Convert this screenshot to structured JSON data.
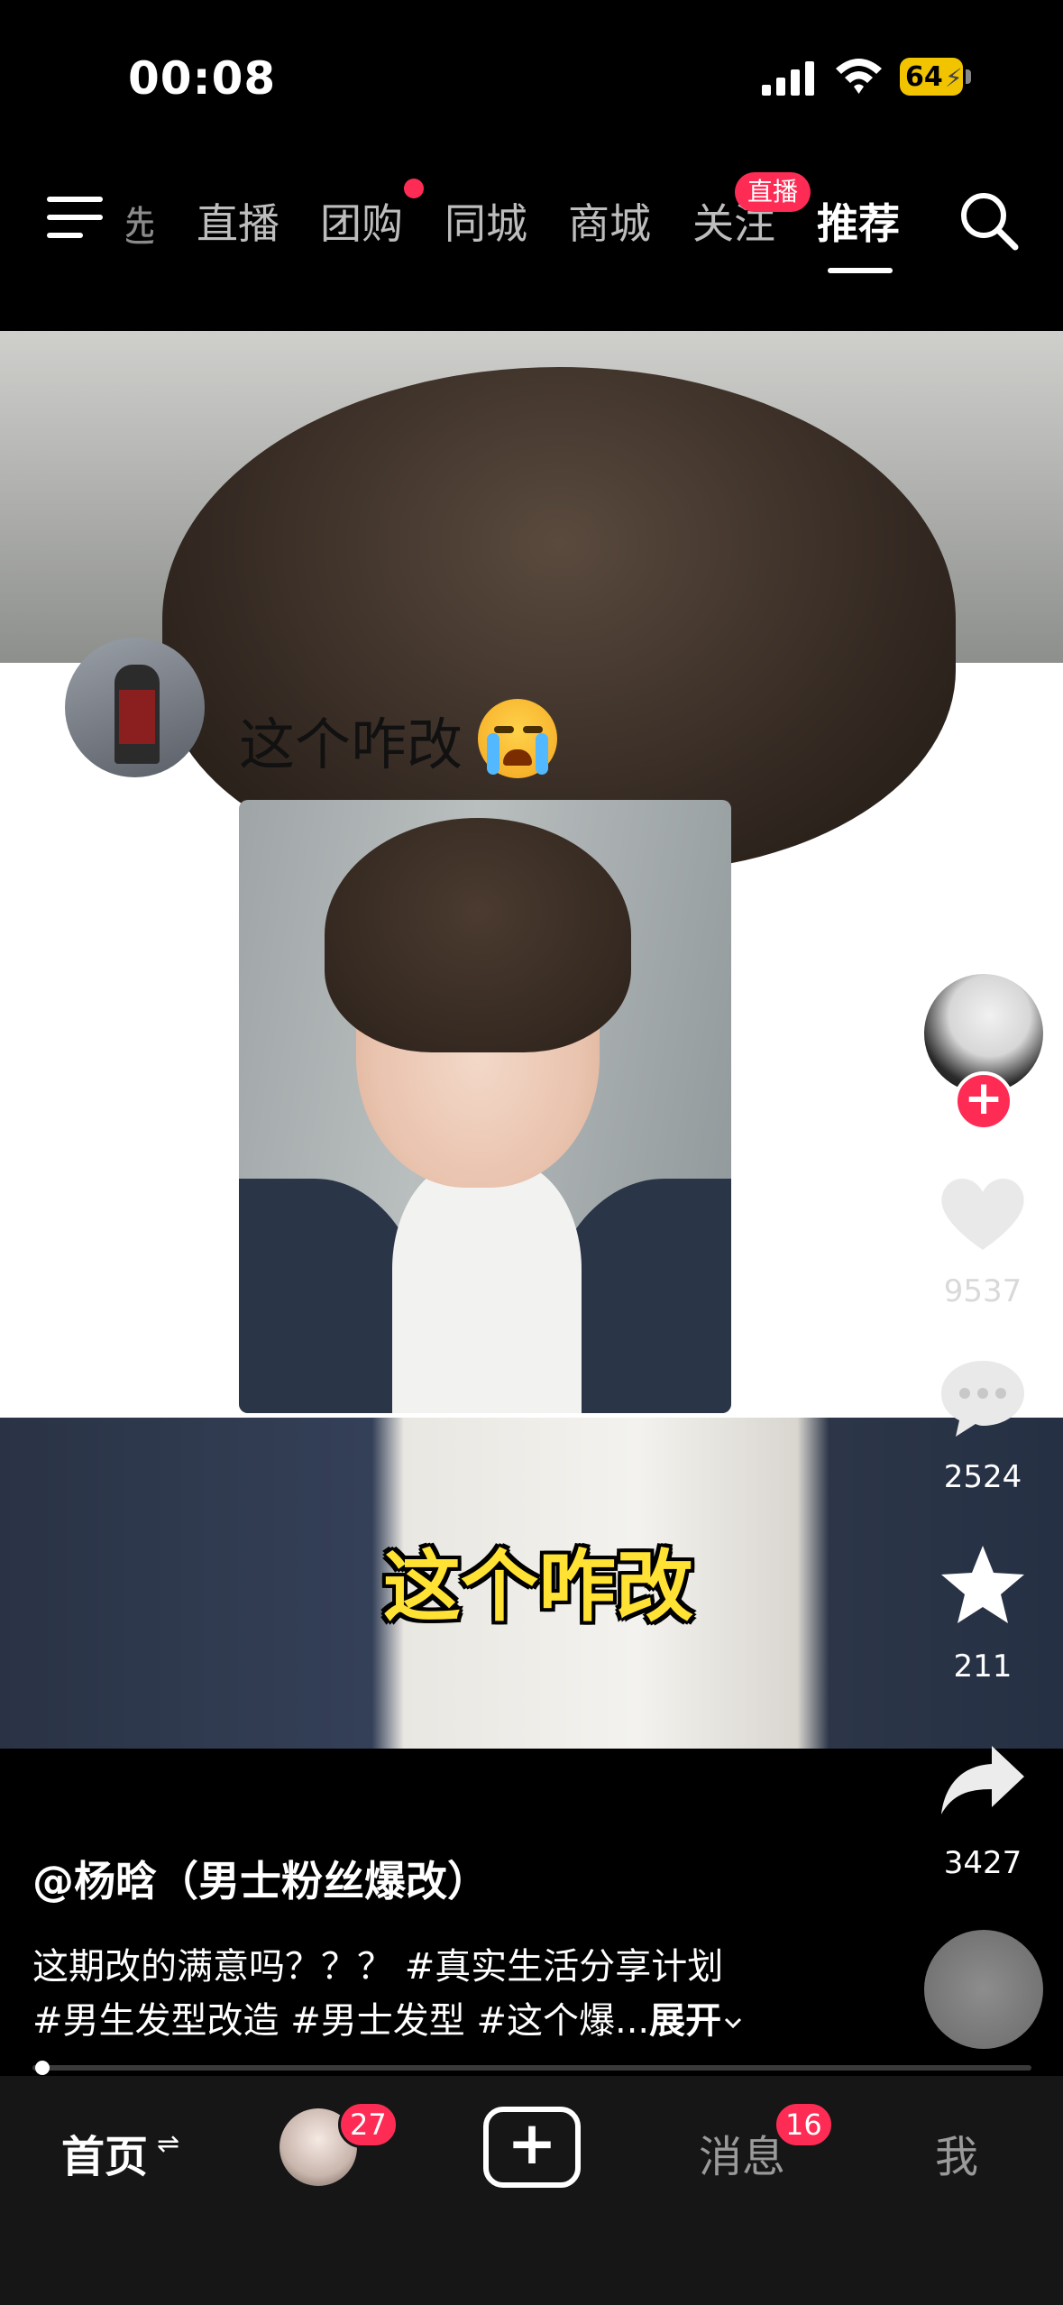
{
  "status_bar": {
    "time": "00:08",
    "battery": "64"
  },
  "top_nav": {
    "partial_tab": "选",
    "tabs": [
      {
        "label": "直播"
      },
      {
        "label": "团购"
      },
      {
        "label": "同城"
      },
      {
        "label": "商城"
      },
      {
        "label": "关注"
      },
      {
        "label": "推荐",
        "active": true
      }
    ],
    "live_badge": "直播"
  },
  "video": {
    "post_text": "这个咋改",
    "caption": "这个咋改"
  },
  "right_rail": {
    "likes": "9537",
    "comments": "2524",
    "favorites": "211",
    "shares": "3427"
  },
  "overlay": {
    "author": "@杨晗（男士粉丝爆改）",
    "description_line1": "这期改的满意吗？？？ #真实生活分享计划",
    "description_line2": "#男生发型改造 #男士发型 #这个爆...",
    "expand": "展开"
  },
  "progress": {
    "value": 0.01
  },
  "bottom_bar": {
    "home": "首页",
    "friends_badge": "27",
    "messages": "消息",
    "messages_badge": "16",
    "me": "我"
  },
  "colors": {
    "accent": "#fe2c55",
    "caption_yellow": "#ffe234",
    "battery": "#f2c400"
  }
}
